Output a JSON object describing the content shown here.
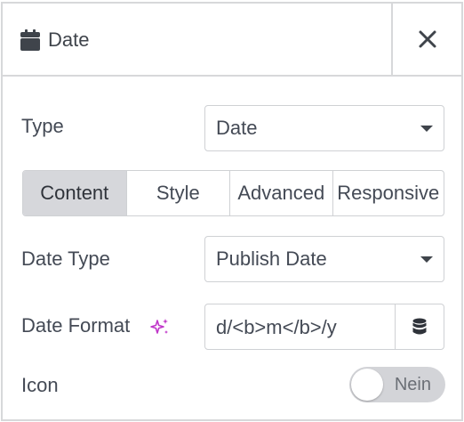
{
  "header": {
    "icon": "calendar-icon",
    "title": "Date",
    "close_icon": "close-icon"
  },
  "type_field": {
    "label": "Type",
    "value": "Date"
  },
  "tabs": [
    {
      "label": "Content",
      "active": true
    },
    {
      "label": "Style",
      "active": false
    },
    {
      "label": "Advanced",
      "active": false
    },
    {
      "label": "Responsive",
      "active": false
    }
  ],
  "date_type": {
    "label": "Date Type",
    "value": "Publish Date"
  },
  "date_format": {
    "label": "Date Format",
    "value": "d/<b>m</b>/y",
    "ai_icon": "sparkle-icon",
    "dynamic_icon": "database-icon"
  },
  "icon_field": {
    "label": "Icon",
    "toggle_text": "Nein",
    "on": false
  },
  "colors": {
    "accent_ai": "#c036c9",
    "tab_active_bg": "#d6d7db",
    "border": "#cfd1d4"
  }
}
